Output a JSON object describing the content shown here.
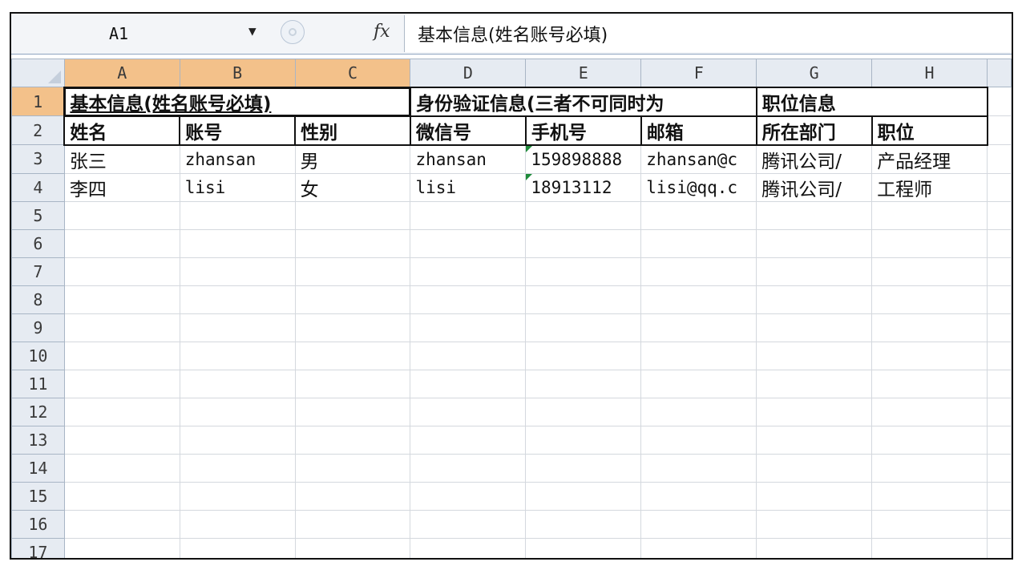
{
  "formula_bar": {
    "name_box": "A1",
    "fx_label": "fx",
    "content": "基本信息(姓名账号必填)"
  },
  "columns": [
    "A",
    "B",
    "C",
    "D",
    "E",
    "F",
    "G",
    "H"
  ],
  "rows": [
    "1",
    "2",
    "3",
    "4",
    "5",
    "6",
    "7",
    "8",
    "9",
    "10",
    "11",
    "12",
    "13",
    "14",
    "15",
    "16",
    "17"
  ],
  "cells": {
    "r1": {
      "a": "基本信息(姓名账号必填)",
      "d": "身份验证信息(三者不可同时为",
      "g": "职位信息"
    },
    "r2": [
      "姓名",
      "账号",
      "性别",
      "微信号",
      "手机号",
      "邮箱",
      "所在部门",
      "职位"
    ],
    "r3": [
      "张三",
      "zhansan",
      "男",
      "zhansan",
      "159898888",
      "zhansan@c",
      "腾讯公司/",
      "产品经理"
    ],
    "r4": [
      "李四",
      "lisi",
      "女",
      "lisi",
      "18913112",
      "lisi@qq.c",
      "腾讯公司/",
      "工程师"
    ]
  }
}
